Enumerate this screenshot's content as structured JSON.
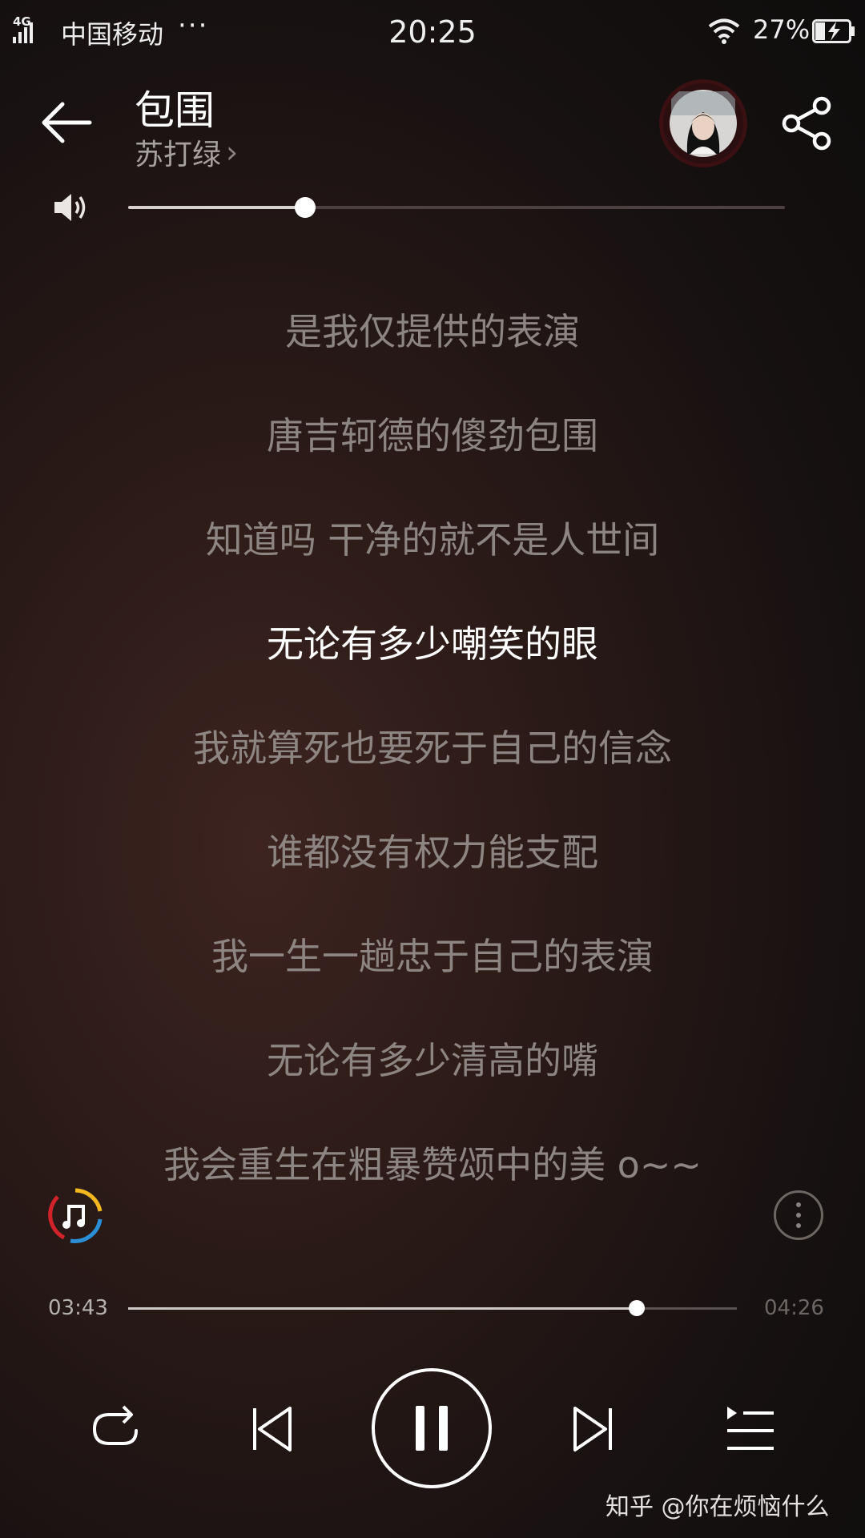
{
  "status_bar": {
    "network": "4G",
    "carrier": "中国移动",
    "more": "···",
    "time": "20:25",
    "battery": "27%"
  },
  "header": {
    "title": "包围",
    "artist": "苏打绿",
    "artist_chevron": "›"
  },
  "volume": {
    "level": 0.27
  },
  "lyrics": {
    "partial_top": "",
    "lines": [
      "是我仅提供的表演",
      "唐吉轲德的傻劲包围",
      "知道吗 干净的就不是人世间",
      "无论有多少嘲笑的眼",
      "我就算死也要死于自己的信念",
      "谁都没有权力能支配",
      "我一生一趟忠于自己的表演",
      "无论有多少清高的嘴",
      "我会重生在粗暴赞颂中的美 o~~"
    ],
    "active_index": 3
  },
  "player": {
    "current_time": "03:43",
    "duration": "04:26",
    "progress": 0.836
  },
  "watermark": "知乎 @你在烦恼什么",
  "colors": {
    "background": "#2a1a17",
    "lyric_inactive": "#8d8582",
    "lyric_active": "#ffffff",
    "accent_red": "#d2232a",
    "accent_yellow": "#f2b720",
    "accent_blue": "#2a8fd6"
  },
  "icons": {
    "back": "arrow-left-icon",
    "share": "share-icon",
    "volume": "speaker-icon",
    "disc": "music-note-ring-icon",
    "more": "more-vertical-icon",
    "repeat": "repeat-icon",
    "prev": "skip-previous-icon",
    "play": "pause-icon",
    "next": "skip-next-icon",
    "playlist": "playlist-icon"
  }
}
